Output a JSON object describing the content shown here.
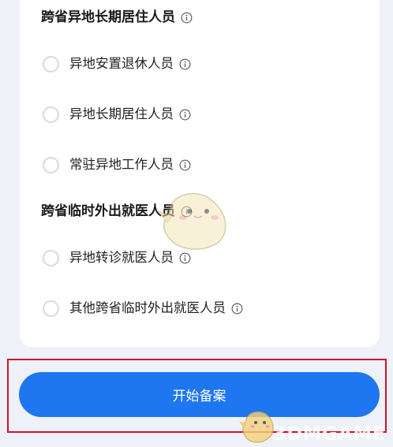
{
  "sections": [
    {
      "title": "跨省异地长期居住人员",
      "options": [
        {
          "label": "异地安置退休人员"
        },
        {
          "label": "异地长期居住人员"
        },
        {
          "label": "常驻异地工作人员"
        }
      ]
    },
    {
      "title": "跨省临时外出就医人员",
      "options": [
        {
          "label": "异地转诊就医人员"
        },
        {
          "label": "其他跨省临时外出就医人员"
        }
      ]
    }
  ],
  "start_button": {
    "label": "开始备案"
  },
  "watermark": {
    "text": "3DMGAME"
  },
  "colors": {
    "accent": "#1e76f0",
    "highlight_border": "#d0112b",
    "background": "#eef2f8",
    "radio_border": "#d9d9d9"
  },
  "icons": {
    "info": "info-icon",
    "radio": "radio-unchecked"
  }
}
